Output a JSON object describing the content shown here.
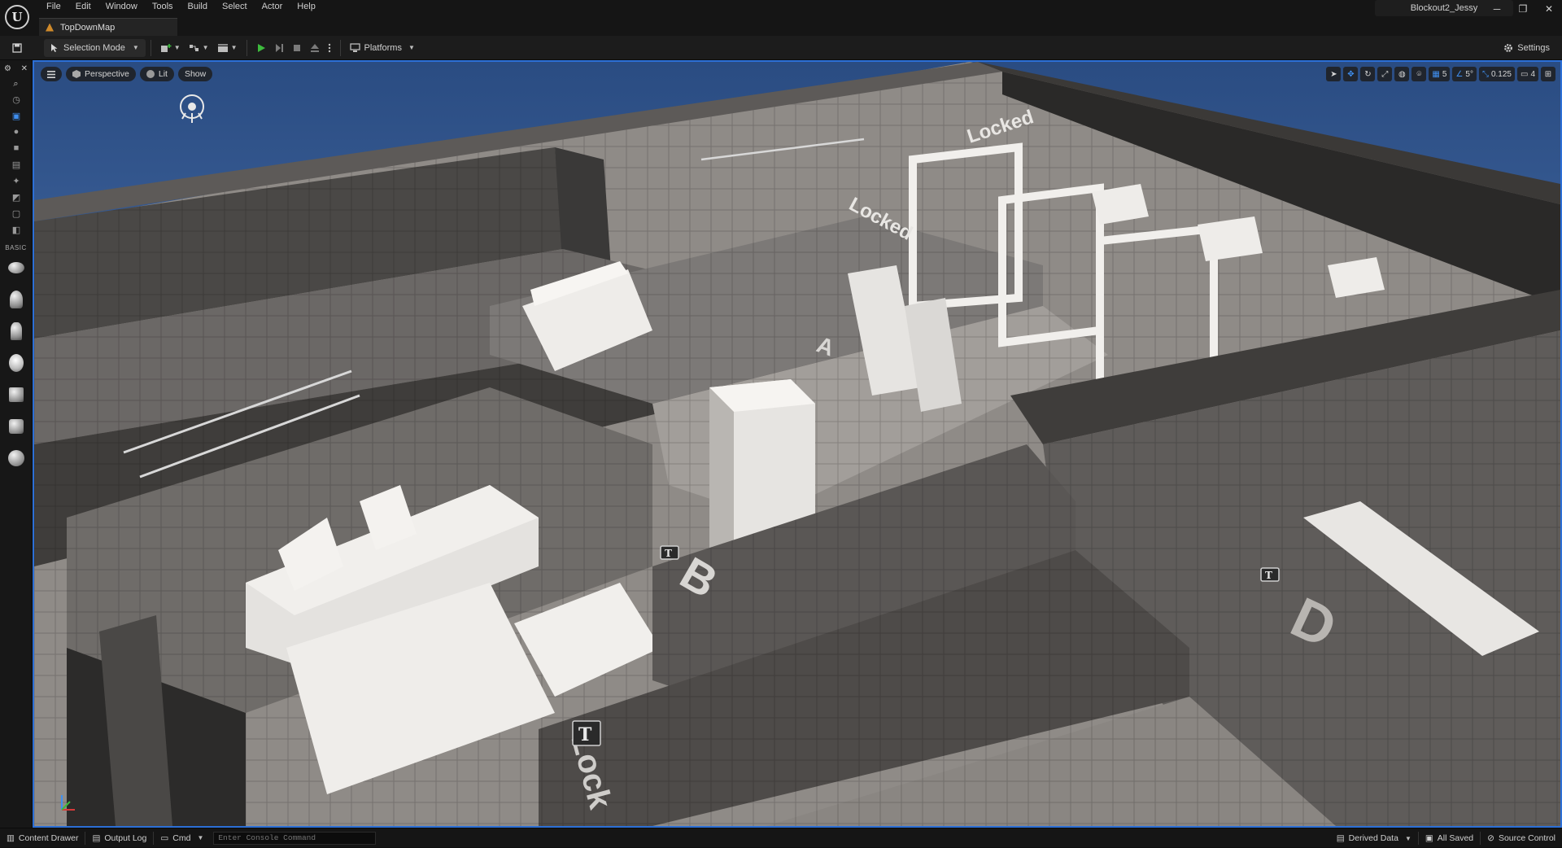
{
  "window": {
    "project_name": "Blockout2_Jessy",
    "controls": {
      "minimize": "─",
      "restore": "❐",
      "close": "✕"
    }
  },
  "menu": [
    "File",
    "Edit",
    "Window",
    "Tools",
    "Build",
    "Select",
    "Actor",
    "Help"
  ],
  "level_tab": {
    "label": "TopDownMap"
  },
  "toolbar": {
    "mode": "Selection Mode",
    "platforms": "Platforms",
    "settings": "Settings"
  },
  "left_panel": {
    "section_label": "BASIC"
  },
  "viewport": {
    "perspective": "Perspective",
    "lit": "Lit",
    "show": "Show",
    "grid_snap": "5",
    "rotation_snap": "5°",
    "scale_snap": "0.125",
    "camera_speed": "4"
  },
  "scene_labels": {
    "locked_1": "Locked",
    "locked_2": "Locked",
    "locked_3": "Lock",
    "room_a": "A",
    "room_b": "B",
    "room_d": "D"
  },
  "statusbar": {
    "content_drawer": "Content Drawer",
    "output_log": "Output Log",
    "cmd": "Cmd",
    "console_placeholder": "Enter Console Command",
    "derived_data": "Derived Data",
    "all_saved": "All Saved",
    "source_control": "Source Control"
  },
  "colors": {
    "viewport_border": "#2c6fd6",
    "sky": "#2a4c82",
    "play_green": "#3dbb3d",
    "accent_blue": "#3f8ff0"
  }
}
